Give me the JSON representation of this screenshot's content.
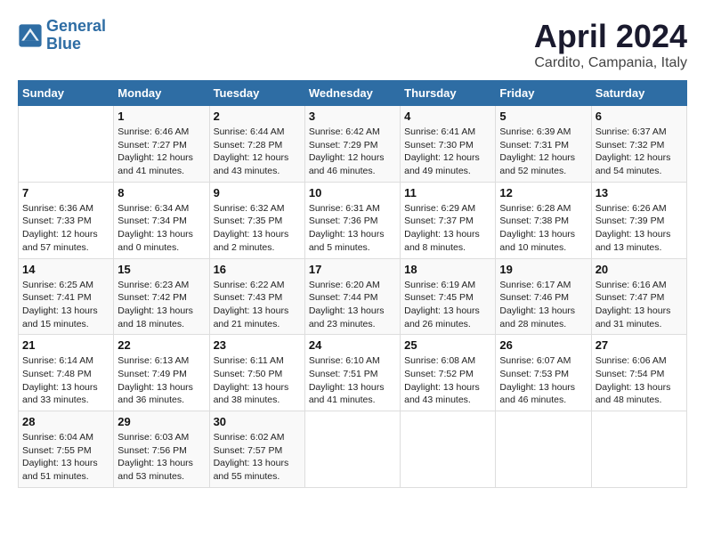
{
  "header": {
    "logo_line1": "General",
    "logo_line2": "Blue",
    "title": "April 2024",
    "subtitle": "Cardito, Campania, Italy"
  },
  "days_of_week": [
    "Sunday",
    "Monday",
    "Tuesday",
    "Wednesday",
    "Thursday",
    "Friday",
    "Saturday"
  ],
  "weeks": [
    [
      {
        "day": "",
        "info": ""
      },
      {
        "day": "1",
        "info": "Sunrise: 6:46 AM\nSunset: 7:27 PM\nDaylight: 12 hours\nand 41 minutes."
      },
      {
        "day": "2",
        "info": "Sunrise: 6:44 AM\nSunset: 7:28 PM\nDaylight: 12 hours\nand 43 minutes."
      },
      {
        "day": "3",
        "info": "Sunrise: 6:42 AM\nSunset: 7:29 PM\nDaylight: 12 hours\nand 46 minutes."
      },
      {
        "day": "4",
        "info": "Sunrise: 6:41 AM\nSunset: 7:30 PM\nDaylight: 12 hours\nand 49 minutes."
      },
      {
        "day": "5",
        "info": "Sunrise: 6:39 AM\nSunset: 7:31 PM\nDaylight: 12 hours\nand 52 minutes."
      },
      {
        "day": "6",
        "info": "Sunrise: 6:37 AM\nSunset: 7:32 PM\nDaylight: 12 hours\nand 54 minutes."
      }
    ],
    [
      {
        "day": "7",
        "info": "Sunrise: 6:36 AM\nSunset: 7:33 PM\nDaylight: 12 hours\nand 57 minutes."
      },
      {
        "day": "8",
        "info": "Sunrise: 6:34 AM\nSunset: 7:34 PM\nDaylight: 13 hours\nand 0 minutes."
      },
      {
        "day": "9",
        "info": "Sunrise: 6:32 AM\nSunset: 7:35 PM\nDaylight: 13 hours\nand 2 minutes."
      },
      {
        "day": "10",
        "info": "Sunrise: 6:31 AM\nSunset: 7:36 PM\nDaylight: 13 hours\nand 5 minutes."
      },
      {
        "day": "11",
        "info": "Sunrise: 6:29 AM\nSunset: 7:37 PM\nDaylight: 13 hours\nand 8 minutes."
      },
      {
        "day": "12",
        "info": "Sunrise: 6:28 AM\nSunset: 7:38 PM\nDaylight: 13 hours\nand 10 minutes."
      },
      {
        "day": "13",
        "info": "Sunrise: 6:26 AM\nSunset: 7:39 PM\nDaylight: 13 hours\nand 13 minutes."
      }
    ],
    [
      {
        "day": "14",
        "info": "Sunrise: 6:25 AM\nSunset: 7:41 PM\nDaylight: 13 hours\nand 15 minutes."
      },
      {
        "day": "15",
        "info": "Sunrise: 6:23 AM\nSunset: 7:42 PM\nDaylight: 13 hours\nand 18 minutes."
      },
      {
        "day": "16",
        "info": "Sunrise: 6:22 AM\nSunset: 7:43 PM\nDaylight: 13 hours\nand 21 minutes."
      },
      {
        "day": "17",
        "info": "Sunrise: 6:20 AM\nSunset: 7:44 PM\nDaylight: 13 hours\nand 23 minutes."
      },
      {
        "day": "18",
        "info": "Sunrise: 6:19 AM\nSunset: 7:45 PM\nDaylight: 13 hours\nand 26 minutes."
      },
      {
        "day": "19",
        "info": "Sunrise: 6:17 AM\nSunset: 7:46 PM\nDaylight: 13 hours\nand 28 minutes."
      },
      {
        "day": "20",
        "info": "Sunrise: 6:16 AM\nSunset: 7:47 PM\nDaylight: 13 hours\nand 31 minutes."
      }
    ],
    [
      {
        "day": "21",
        "info": "Sunrise: 6:14 AM\nSunset: 7:48 PM\nDaylight: 13 hours\nand 33 minutes."
      },
      {
        "day": "22",
        "info": "Sunrise: 6:13 AM\nSunset: 7:49 PM\nDaylight: 13 hours\nand 36 minutes."
      },
      {
        "day": "23",
        "info": "Sunrise: 6:11 AM\nSunset: 7:50 PM\nDaylight: 13 hours\nand 38 minutes."
      },
      {
        "day": "24",
        "info": "Sunrise: 6:10 AM\nSunset: 7:51 PM\nDaylight: 13 hours\nand 41 minutes."
      },
      {
        "day": "25",
        "info": "Sunrise: 6:08 AM\nSunset: 7:52 PM\nDaylight: 13 hours\nand 43 minutes."
      },
      {
        "day": "26",
        "info": "Sunrise: 6:07 AM\nSunset: 7:53 PM\nDaylight: 13 hours\nand 46 minutes."
      },
      {
        "day": "27",
        "info": "Sunrise: 6:06 AM\nSunset: 7:54 PM\nDaylight: 13 hours\nand 48 minutes."
      }
    ],
    [
      {
        "day": "28",
        "info": "Sunrise: 6:04 AM\nSunset: 7:55 PM\nDaylight: 13 hours\nand 51 minutes."
      },
      {
        "day": "29",
        "info": "Sunrise: 6:03 AM\nSunset: 7:56 PM\nDaylight: 13 hours\nand 53 minutes."
      },
      {
        "day": "30",
        "info": "Sunrise: 6:02 AM\nSunset: 7:57 PM\nDaylight: 13 hours\nand 55 minutes."
      },
      {
        "day": "",
        "info": ""
      },
      {
        "day": "",
        "info": ""
      },
      {
        "day": "",
        "info": ""
      },
      {
        "day": "",
        "info": ""
      }
    ]
  ]
}
